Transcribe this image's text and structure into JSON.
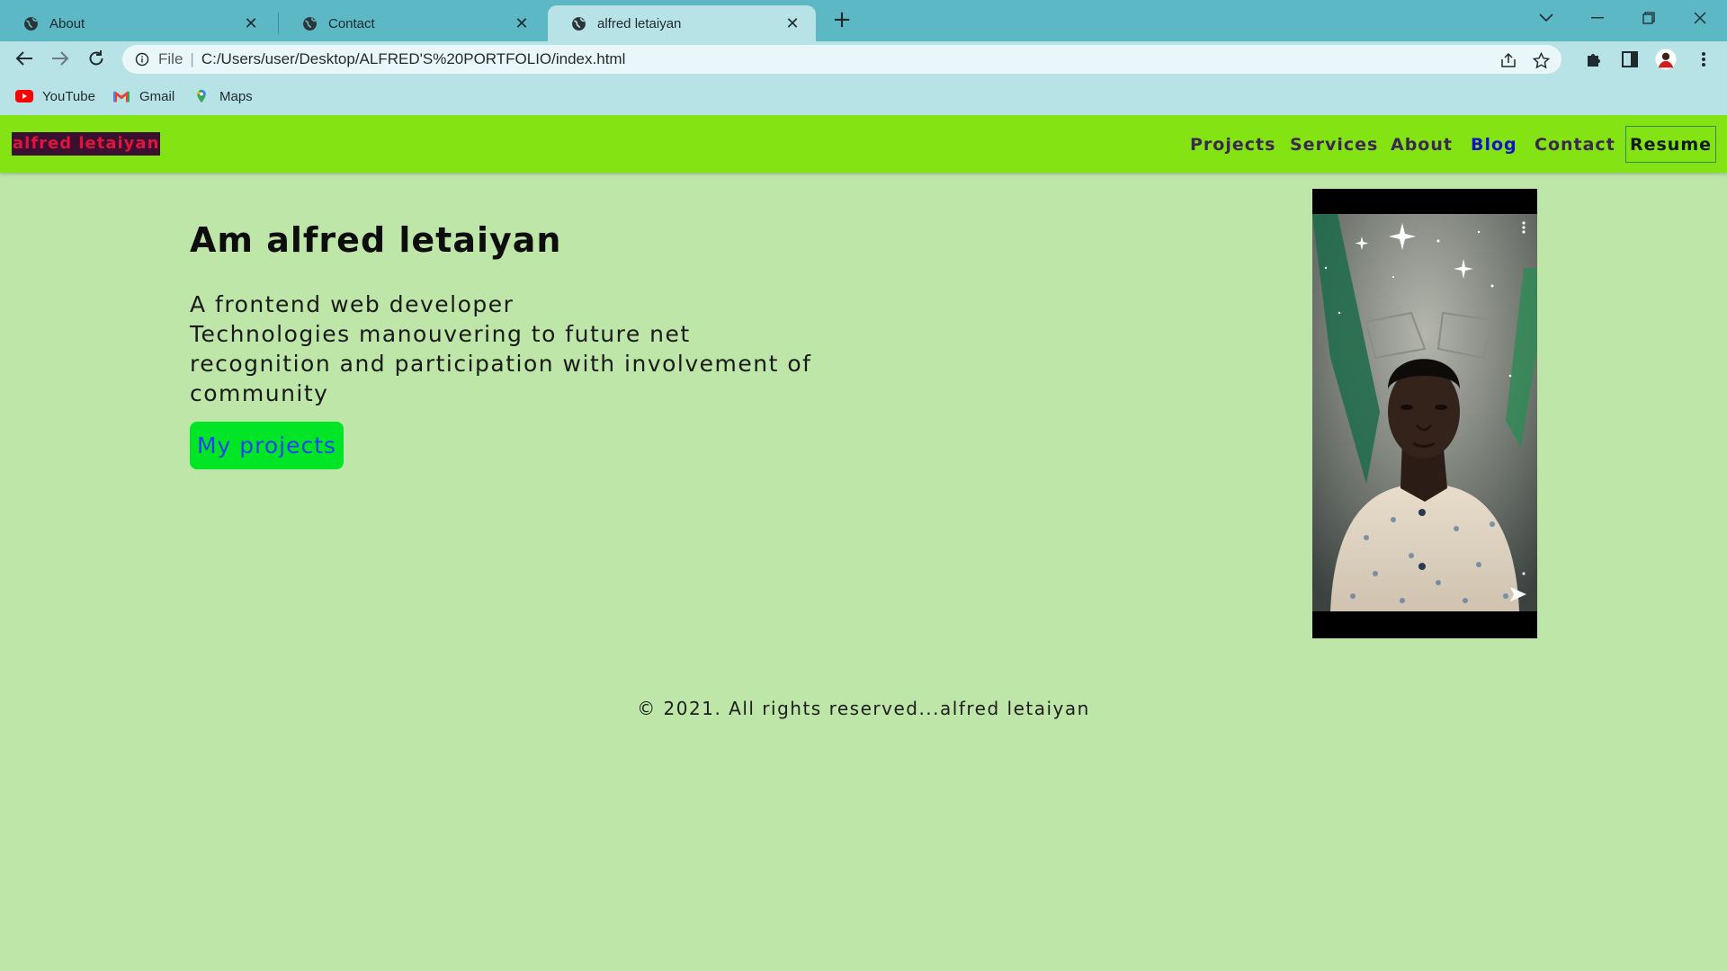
{
  "browser": {
    "tabs": [
      {
        "title": "About"
      },
      {
        "title": "Contact"
      },
      {
        "title": "alfred letaiyan"
      }
    ],
    "address": {
      "scheme": "File",
      "url": "C:/Users/user/Desktop/ALFRED'S%20PORTFOLIO/index.html"
    },
    "bookmarks": [
      {
        "label": "YouTube",
        "icon": "youtube-icon"
      },
      {
        "label": "Gmail",
        "icon": "gmail-icon"
      },
      {
        "label": "Maps",
        "icon": "maps-icon"
      }
    ]
  },
  "site": {
    "logo": "alfred letaiyan",
    "nav": {
      "projects": "Projects",
      "services": "Services",
      "about": "About",
      "blog": "Blog",
      "contact": "Contact",
      "resume": "Resume"
    },
    "hero": {
      "title": "Am alfred letaiyan",
      "lines": [
        "A frontend web developer",
        "Technologies manouvering to future net",
        "recognition and participation with involvement of",
        "community"
      ],
      "button": "My projects"
    },
    "footer": "© 2021. All rights reserved...alfred letaiyan"
  },
  "colors": {
    "page_bg": "#bee6a8",
    "nav_bg": "#84e313",
    "button_bg": "#00e626",
    "button_text": "#2244ee",
    "logo_text": "#e0143c",
    "tabbar": "#5cb8c4"
  }
}
